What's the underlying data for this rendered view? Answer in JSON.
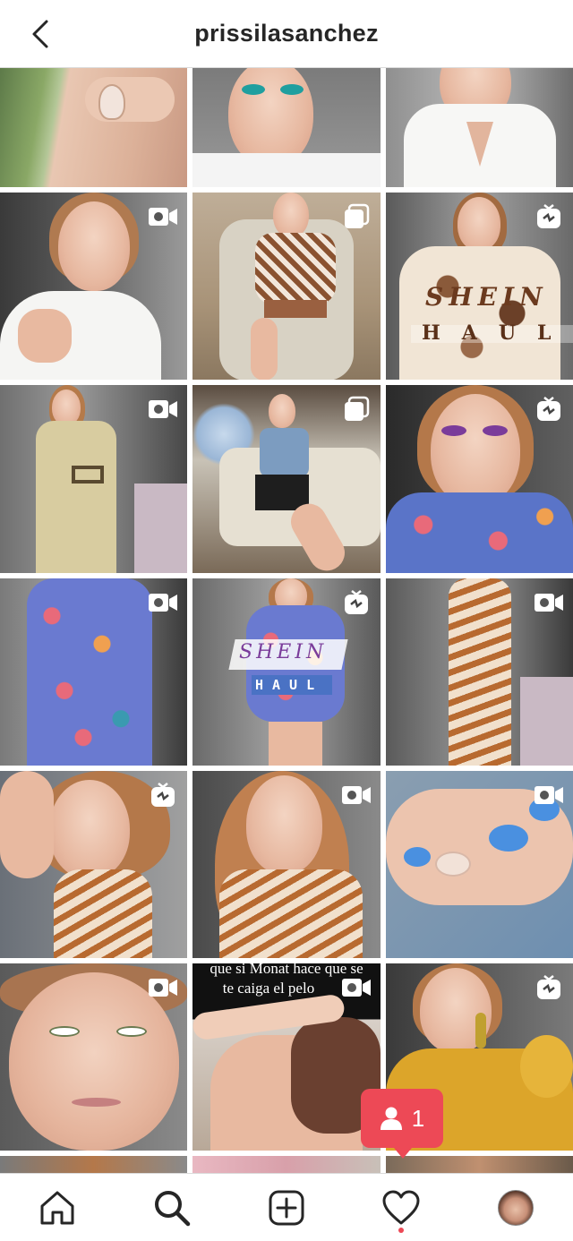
{
  "header": {
    "title": "prissilasanchez",
    "back_icon": "chevron-left-icon"
  },
  "grid": {
    "posts": [
      {
        "row": 0,
        "col": 0,
        "kind": "photo",
        "badge": null,
        "theme": "hand"
      },
      {
        "row": 0,
        "col": 1,
        "kind": "photo",
        "badge": null,
        "theme": "face-teal"
      },
      {
        "row": 0,
        "col": 2,
        "kind": "photo",
        "badge": null,
        "theme": "white-shirt"
      },
      {
        "row": 1,
        "col": 0,
        "kind": "video",
        "badge": "video-camera-icon",
        "theme": "white-shirt-face"
      },
      {
        "row": 1,
        "col": 1,
        "kind": "carousel",
        "badge": "carousel-icon",
        "theme": "armchair-zebra"
      },
      {
        "row": 1,
        "col": 2,
        "kind": "igtv",
        "badge": "igtv-icon",
        "theme": "shein-haul",
        "overlay_top": "SHEIN",
        "overlay_bottom": "HAUL"
      },
      {
        "row": 2,
        "col": 0,
        "kind": "video",
        "badge": "video-camera-icon",
        "theme": "beige-outfit"
      },
      {
        "row": 2,
        "col": 1,
        "kind": "carousel",
        "badge": "carousel-icon",
        "theme": "sofa-blue-top"
      },
      {
        "row": 2,
        "col": 2,
        "kind": "igtv",
        "badge": "igtv-icon",
        "theme": "floral-face"
      },
      {
        "row": 3,
        "col": 0,
        "kind": "video",
        "badge": "video-camera-icon",
        "theme": "floral-dress"
      },
      {
        "row": 3,
        "col": 1,
        "kind": "igtv",
        "badge": "igtv-icon",
        "theme": "shein-haul-floral",
        "overlay_top": "SHEIN",
        "overlay_bottom": "HAUL"
      },
      {
        "row": 3,
        "col": 2,
        "kind": "video",
        "badge": "video-camera-icon",
        "theme": "tie-dye-dress"
      },
      {
        "row": 4,
        "col": 0,
        "kind": "igtv",
        "badge": "igtv-icon",
        "theme": "halter-pose"
      },
      {
        "row": 4,
        "col": 1,
        "kind": "video",
        "badge": "video-camera-icon",
        "theme": "halter-hair"
      },
      {
        "row": 4,
        "col": 2,
        "kind": "video",
        "badge": "video-camera-icon",
        "theme": "blue-nails"
      },
      {
        "row": 5,
        "col": 0,
        "kind": "video",
        "badge": "video-camera-icon",
        "theme": "bare-face"
      },
      {
        "row": 5,
        "col": 1,
        "kind": "video",
        "badge": "video-camera-icon",
        "theme": "hair-wash",
        "caption_line1": "que si Monat hace que se",
        "caption_line2": "te caiga el pelo"
      },
      {
        "row": 5,
        "col": 2,
        "kind": "igtv",
        "badge": "igtv-icon",
        "theme": "mustard-top"
      }
    ]
  },
  "notification": {
    "icon": "person-icon",
    "count": "1"
  },
  "nav": {
    "items": [
      {
        "name": "home",
        "icon": "home-icon"
      },
      {
        "name": "search",
        "icon": "search-icon"
      },
      {
        "name": "new-post",
        "icon": "add-post-icon"
      },
      {
        "name": "activity",
        "icon": "heart-icon"
      },
      {
        "name": "profile",
        "icon": "profile-avatar"
      }
    ]
  },
  "colors": {
    "accent_red": "#ed4956",
    "text_dark": "#262626",
    "border": "#dbdbdb"
  }
}
